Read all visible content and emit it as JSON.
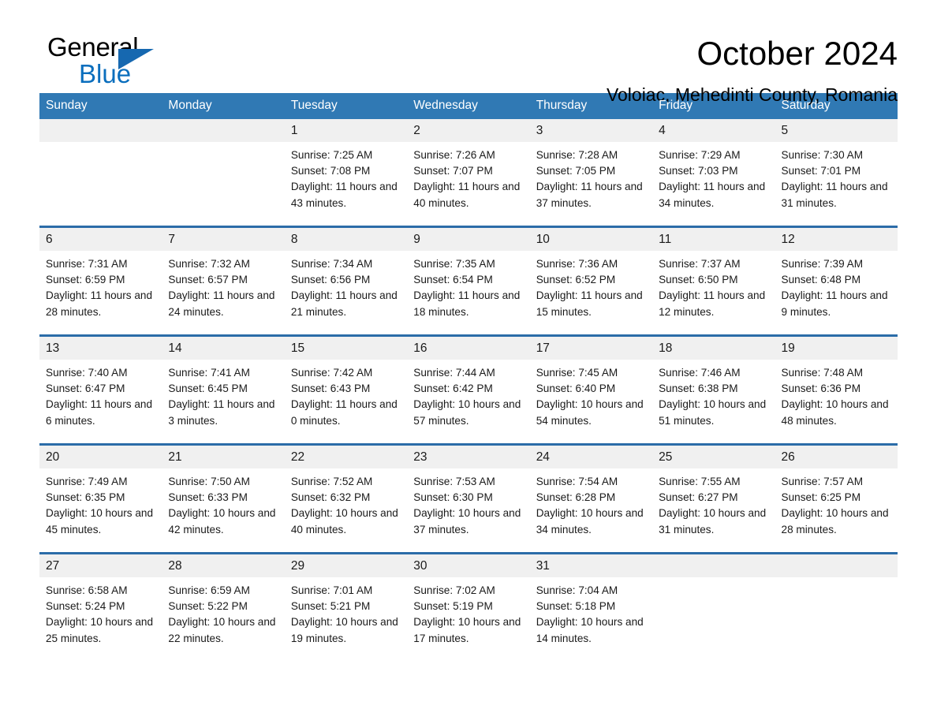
{
  "brand": {
    "name_dark": "General",
    "name_light": "Blue",
    "triangle_color": "#1668b0",
    "blue": "#0a6ebd"
  },
  "header": {
    "title": "October 2024",
    "subtitle": "Voloiac, Mehedinti County, Romania"
  },
  "theme": {
    "header_bg": "#3079b4",
    "row_divider": "#2b6ca8",
    "day_band_bg": "#f0f0f0",
    "text": "#1a1a1a"
  },
  "weekdays": [
    "Sunday",
    "Monday",
    "Tuesday",
    "Wednesday",
    "Thursday",
    "Friday",
    "Saturday"
  ],
  "weeks": [
    [
      {
        "day": "",
        "empty": true
      },
      {
        "day": "",
        "empty": true
      },
      {
        "day": "1",
        "sunrise": "Sunrise: 7:25 AM",
        "sunset": "Sunset: 7:08 PM",
        "daylight": "Daylight: 11 hours and 43 minutes."
      },
      {
        "day": "2",
        "sunrise": "Sunrise: 7:26 AM",
        "sunset": "Sunset: 7:07 PM",
        "daylight": "Daylight: 11 hours and 40 minutes."
      },
      {
        "day": "3",
        "sunrise": "Sunrise: 7:28 AM",
        "sunset": "Sunset: 7:05 PM",
        "daylight": "Daylight: 11 hours and 37 minutes."
      },
      {
        "day": "4",
        "sunrise": "Sunrise: 7:29 AM",
        "sunset": "Sunset: 7:03 PM",
        "daylight": "Daylight: 11 hours and 34 minutes."
      },
      {
        "day": "5",
        "sunrise": "Sunrise: 7:30 AM",
        "sunset": "Sunset: 7:01 PM",
        "daylight": "Daylight: 11 hours and 31 minutes."
      }
    ],
    [
      {
        "day": "6",
        "sunrise": "Sunrise: 7:31 AM",
        "sunset": "Sunset: 6:59 PM",
        "daylight": "Daylight: 11 hours and 28 minutes."
      },
      {
        "day": "7",
        "sunrise": "Sunrise: 7:32 AM",
        "sunset": "Sunset: 6:57 PM",
        "daylight": "Daylight: 11 hours and 24 minutes."
      },
      {
        "day": "8",
        "sunrise": "Sunrise: 7:34 AM",
        "sunset": "Sunset: 6:56 PM",
        "daylight": "Daylight: 11 hours and 21 minutes."
      },
      {
        "day": "9",
        "sunrise": "Sunrise: 7:35 AM",
        "sunset": "Sunset: 6:54 PM",
        "daylight": "Daylight: 11 hours and 18 minutes."
      },
      {
        "day": "10",
        "sunrise": "Sunrise: 7:36 AM",
        "sunset": "Sunset: 6:52 PM",
        "daylight": "Daylight: 11 hours and 15 minutes."
      },
      {
        "day": "11",
        "sunrise": "Sunrise: 7:37 AM",
        "sunset": "Sunset: 6:50 PM",
        "daylight": "Daylight: 11 hours and 12 minutes."
      },
      {
        "day": "12",
        "sunrise": "Sunrise: 7:39 AM",
        "sunset": "Sunset: 6:48 PM",
        "daylight": "Daylight: 11 hours and 9 minutes."
      }
    ],
    [
      {
        "day": "13",
        "sunrise": "Sunrise: 7:40 AM",
        "sunset": "Sunset: 6:47 PM",
        "daylight": "Daylight: 11 hours and 6 minutes."
      },
      {
        "day": "14",
        "sunrise": "Sunrise: 7:41 AM",
        "sunset": "Sunset: 6:45 PM",
        "daylight": "Daylight: 11 hours and 3 minutes."
      },
      {
        "day": "15",
        "sunrise": "Sunrise: 7:42 AM",
        "sunset": "Sunset: 6:43 PM",
        "daylight": "Daylight: 11 hours and 0 minutes."
      },
      {
        "day": "16",
        "sunrise": "Sunrise: 7:44 AM",
        "sunset": "Sunset: 6:42 PM",
        "daylight": "Daylight: 10 hours and 57 minutes."
      },
      {
        "day": "17",
        "sunrise": "Sunrise: 7:45 AM",
        "sunset": "Sunset: 6:40 PM",
        "daylight": "Daylight: 10 hours and 54 minutes."
      },
      {
        "day": "18",
        "sunrise": "Sunrise: 7:46 AM",
        "sunset": "Sunset: 6:38 PM",
        "daylight": "Daylight: 10 hours and 51 minutes."
      },
      {
        "day": "19",
        "sunrise": "Sunrise: 7:48 AM",
        "sunset": "Sunset: 6:36 PM",
        "daylight": "Daylight: 10 hours and 48 minutes."
      }
    ],
    [
      {
        "day": "20",
        "sunrise": "Sunrise: 7:49 AM",
        "sunset": "Sunset: 6:35 PM",
        "daylight": "Daylight: 10 hours and 45 minutes."
      },
      {
        "day": "21",
        "sunrise": "Sunrise: 7:50 AM",
        "sunset": "Sunset: 6:33 PM",
        "daylight": "Daylight: 10 hours and 42 minutes."
      },
      {
        "day": "22",
        "sunrise": "Sunrise: 7:52 AM",
        "sunset": "Sunset: 6:32 PM",
        "daylight": "Daylight: 10 hours and 40 minutes."
      },
      {
        "day": "23",
        "sunrise": "Sunrise: 7:53 AM",
        "sunset": "Sunset: 6:30 PM",
        "daylight": "Daylight: 10 hours and 37 minutes."
      },
      {
        "day": "24",
        "sunrise": "Sunrise: 7:54 AM",
        "sunset": "Sunset: 6:28 PM",
        "daylight": "Daylight: 10 hours and 34 minutes."
      },
      {
        "day": "25",
        "sunrise": "Sunrise: 7:55 AM",
        "sunset": "Sunset: 6:27 PM",
        "daylight": "Daylight: 10 hours and 31 minutes."
      },
      {
        "day": "26",
        "sunrise": "Sunrise: 7:57 AM",
        "sunset": "Sunset: 6:25 PM",
        "daylight": "Daylight: 10 hours and 28 minutes."
      }
    ],
    [
      {
        "day": "27",
        "sunrise": "Sunrise: 6:58 AM",
        "sunset": "Sunset: 5:24 PM",
        "daylight": "Daylight: 10 hours and 25 minutes."
      },
      {
        "day": "28",
        "sunrise": "Sunrise: 6:59 AM",
        "sunset": "Sunset: 5:22 PM",
        "daylight": "Daylight: 10 hours and 22 minutes."
      },
      {
        "day": "29",
        "sunrise": "Sunrise: 7:01 AM",
        "sunset": "Sunset: 5:21 PM",
        "daylight": "Daylight: 10 hours and 19 minutes."
      },
      {
        "day": "30",
        "sunrise": "Sunrise: 7:02 AM",
        "sunset": "Sunset: 5:19 PM",
        "daylight": "Daylight: 10 hours and 17 minutes."
      },
      {
        "day": "31",
        "sunrise": "Sunrise: 7:04 AM",
        "sunset": "Sunset: 5:18 PM",
        "daylight": "Daylight: 10 hours and 14 minutes."
      },
      {
        "day": "",
        "empty": true
      },
      {
        "day": "",
        "empty": true
      }
    ]
  ]
}
